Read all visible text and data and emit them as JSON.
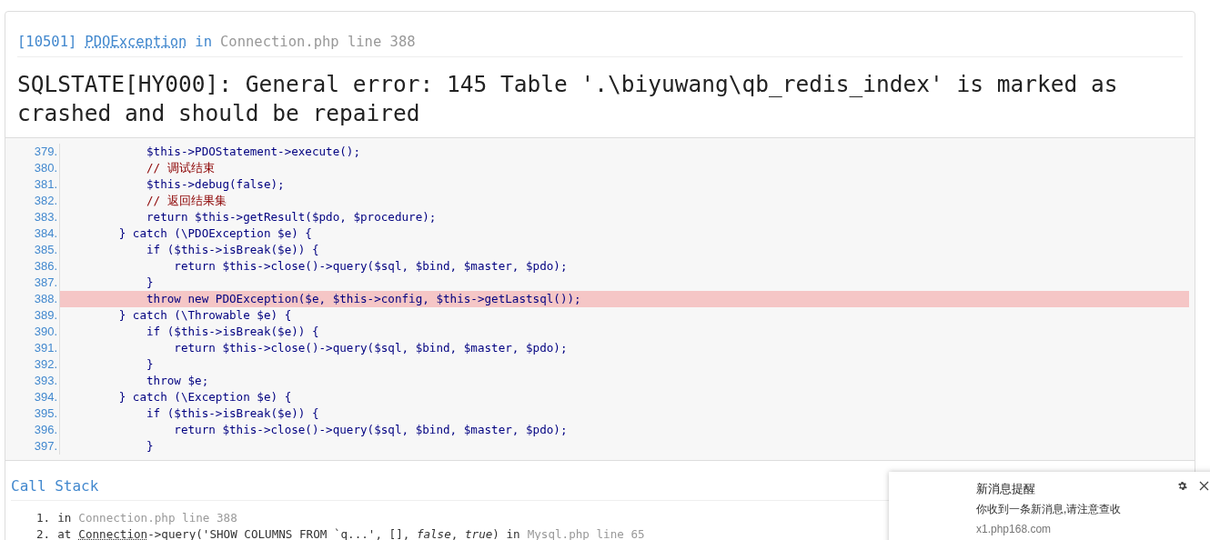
{
  "header": {
    "code": "[10501]",
    "exception": "PDOException",
    "joiner": "in",
    "location": "Connection.php line 388"
  },
  "message": "SQLSTATE[HY000]: General error: 145 Table '.\\biyuwang\\qb_redis_index' is marked as crashed and should be repaired",
  "source": [
    {
      "number": "379.",
      "text": "            $this->PDOStatement->execute();",
      "kind": "code",
      "highlight": false
    },
    {
      "number": "380.",
      "text": "            // 调试结束",
      "kind": "comment",
      "highlight": false
    },
    {
      "number": "381.",
      "text": "            $this->debug(false);",
      "kind": "code",
      "highlight": false
    },
    {
      "number": "382.",
      "text": "            // 返回结果集",
      "kind": "comment",
      "highlight": false
    },
    {
      "number": "383.",
      "text": "            return $this->getResult($pdo, $procedure);",
      "kind": "code",
      "highlight": false
    },
    {
      "number": "384.",
      "text": "        } catch (\\PDOException $e) {",
      "kind": "code",
      "highlight": false
    },
    {
      "number": "385.",
      "text": "            if ($this->isBreak($e)) {",
      "kind": "code",
      "highlight": false
    },
    {
      "number": "386.",
      "text": "                return $this->close()->query($sql, $bind, $master, $pdo);",
      "kind": "code",
      "highlight": false
    },
    {
      "number": "387.",
      "text": "            }",
      "kind": "code",
      "highlight": false
    },
    {
      "number": "388.",
      "text": "            throw new PDOException($e, $this->config, $this->getLastsql());",
      "kind": "code",
      "highlight": true
    },
    {
      "number": "389.",
      "text": "        } catch (\\Throwable $e) {",
      "kind": "code",
      "highlight": false
    },
    {
      "number": "390.",
      "text": "            if ($this->isBreak($e)) {",
      "kind": "code",
      "highlight": false
    },
    {
      "number": "391.",
      "text": "                return $this->close()->query($sql, $bind, $master, $pdo);",
      "kind": "code",
      "highlight": false
    },
    {
      "number": "392.",
      "text": "            }",
      "kind": "code",
      "highlight": false
    },
    {
      "number": "393.",
      "text": "            throw $e;",
      "kind": "code",
      "highlight": false
    },
    {
      "number": "394.",
      "text": "        } catch (\\Exception $e) {",
      "kind": "code",
      "highlight": false
    },
    {
      "number": "395.",
      "text": "            if ($this->isBreak($e)) {",
      "kind": "code",
      "highlight": false
    },
    {
      "number": "396.",
      "text": "                return $this->close()->query($sql, $bind, $master, $pdo);",
      "kind": "code",
      "highlight": false
    },
    {
      "number": "397.",
      "text": "            }",
      "kind": "code",
      "highlight": false
    }
  ],
  "call_stack": {
    "title": "Call Stack",
    "items": [
      {
        "number": "1.",
        "lead": "in",
        "location": "Connection.php line 388"
      },
      {
        "number": "2.",
        "lead": "at",
        "class": "Connection",
        "call": "->query('SHOW COLUMNS FROM `q...', [], *false*, *true*) in",
        "location": "Mysql.php line 65"
      }
    ]
  },
  "notification": {
    "title": "新消息提醒",
    "body": "你收到一条新消息,请注意查收",
    "source": "x1.php168.com"
  }
}
